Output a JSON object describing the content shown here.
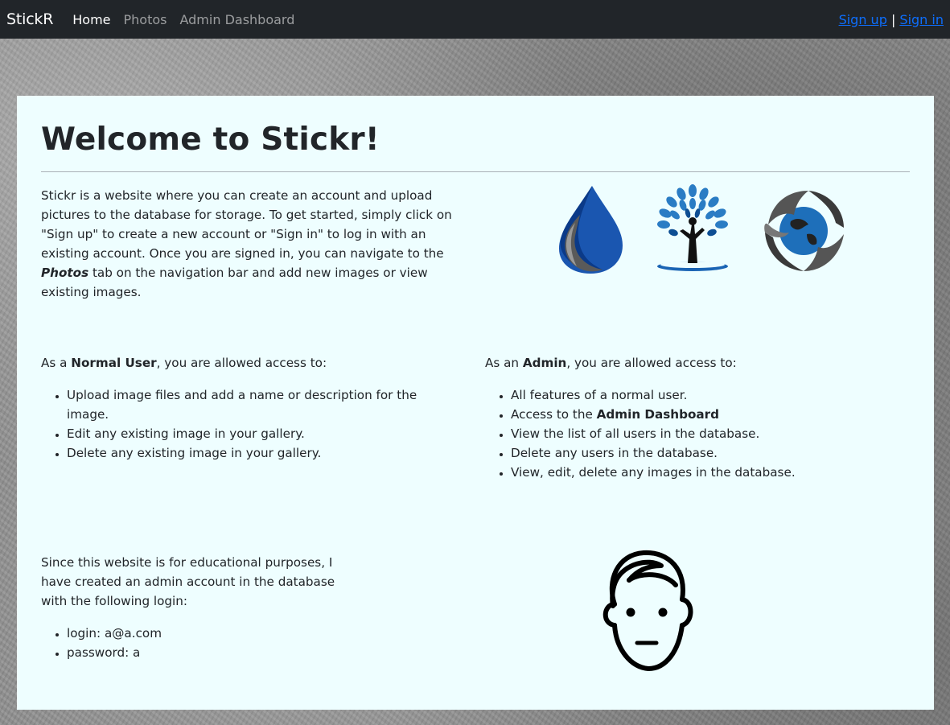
{
  "nav": {
    "brand": "StickR",
    "links": [
      "Home",
      "Photos",
      "Admin Dashboard"
    ],
    "signup": "Sign up",
    "separator": "|",
    "signin": "Sign in"
  },
  "main": {
    "title": "Welcome to Stickr!",
    "intro_before": "Stickr is a website where you can create an account and upload pictures to the database for storage. To get started, simply click on \"Sign up\" to create a new account or \"Sign in\" to log in with an existing account. Once you are signed in, you can navigate to the ",
    "intro_emph": "Photos",
    "intro_after": " tab on the navigation bar and add new images or view existing images.",
    "normal": {
      "prefix": "As a ",
      "role": "Normal User",
      "suffix": ", you are allowed access to:",
      "items": [
        "Upload image files and add a name or description for the image.",
        "Edit any existing image in your gallery.",
        "Delete any existing image in your gallery."
      ]
    },
    "admin": {
      "prefix": "As an ",
      "role": "Admin",
      "suffix": ", you are allowed access to:",
      "item1": "All features of a normal user.",
      "item2_prefix": "Access to the ",
      "item2_bold": "Admin Dashboard",
      "item3": "View the list of all users in the database.",
      "item4": "Delete any users in the database.",
      "item5": "View, edit, delete any images in the database."
    },
    "login_note": "Since this website is for educational purposes, I have created an admin account in the database with the following login:",
    "credentials": [
      "login: a@a.com",
      "password: a"
    ]
  },
  "icons": [
    "water-drop-logo-icon",
    "tree-logo-icon",
    "recycle-globe-logo-icon",
    "face-icon"
  ],
  "colors": {
    "navbar_bg": "#212529",
    "card_bg": "#eefeff",
    "link": "#0d6efd",
    "logo_blue": "#1a64b4"
  }
}
